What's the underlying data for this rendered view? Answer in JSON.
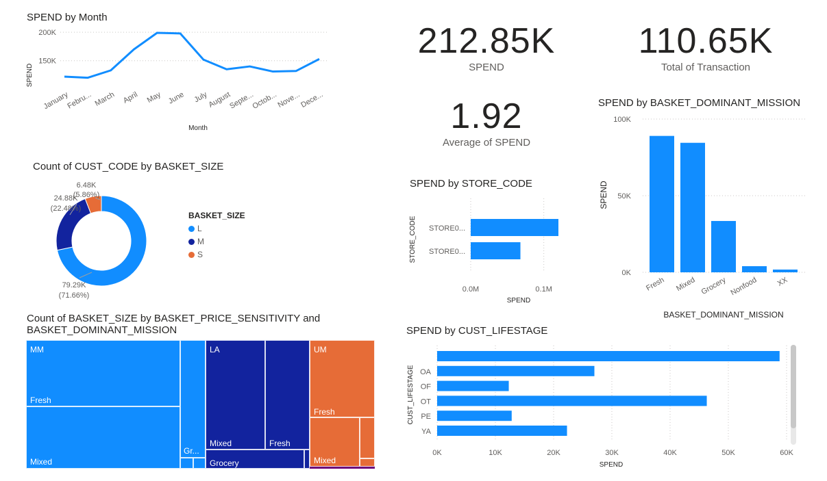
{
  "kpis": {
    "spend": {
      "value": "212.85K",
      "label": "SPEND"
    },
    "transactions": {
      "value": "110.65K",
      "label": "Total of Transaction"
    },
    "avg_spend": {
      "value": "1.92",
      "label": "Average of SPEND"
    }
  },
  "colors": {
    "blue": "#118dff",
    "navy": "#12239e",
    "orange": "#e66c37",
    "purple": "#6b007b"
  },
  "chart_data": [
    {
      "id": "spend_by_month",
      "type": "line",
      "title": "SPEND by Month",
      "xlabel": "Month",
      "ylabel": "SPEND",
      "categories": [
        "January",
        "Febru...",
        "March",
        "April",
        "May",
        "June",
        "July",
        "August",
        "Septe...",
        "Octob...",
        "Nove...",
        "Dece..."
      ],
      "values": [
        122,
        120,
        133,
        170,
        199,
        198,
        152,
        135,
        140,
        131,
        132,
        153
      ],
      "y_ticks": [
        {
          "v": 150,
          "label": "150K"
        },
        {
          "v": 200,
          "label": "200K"
        }
      ],
      "ylim": [
        110,
        205
      ],
      "grid": true
    },
    {
      "id": "cust_by_basket_size",
      "type": "pie",
      "donut": true,
      "title": "Count of CUST_CODE by BASKET_SIZE",
      "legend_title": "BASKET_SIZE",
      "slices": [
        {
          "name": "L",
          "value": 79.29,
          "label": "79.29K",
          "pct": "(71.66%)",
          "color": "#118dff"
        },
        {
          "name": "M",
          "value": 24.88,
          "label": "24.88K",
          "pct": "(22.48%)",
          "color": "#12239e"
        },
        {
          "name": "S",
          "value": 6.48,
          "label": "6.48K",
          "pct": "(5.86%)",
          "color": "#e66c37"
        }
      ]
    },
    {
      "id": "treemap",
      "type": "treemap",
      "title_line1": "Count of BASKET_SIZE by BASKET_PRICE_SENSITIVITY and",
      "title_line2": "BASKET_DOMINANT_MISSION",
      "groups": [
        {
          "name": "MM",
          "children": [
            "Fresh",
            "Mixed",
            "Gr..."
          ]
        },
        {
          "name": "LA",
          "children": [
            "Mixed",
            "Fresh",
            "Grocery"
          ]
        },
        {
          "name": "UM",
          "children": [
            "Fresh",
            "Mixed"
          ]
        }
      ]
    },
    {
      "id": "spend_by_store",
      "type": "bar",
      "orientation": "horizontal",
      "title": "SPEND by STORE_CODE",
      "xlabel": "SPEND",
      "ylabel": "STORE_CODE",
      "categories": [
        "STORE0...",
        "STORE0..."
      ],
      "values": [
        0.12,
        0.068
      ],
      "xlim": [
        0,
        0.12
      ],
      "x_ticks": [
        {
          "v": 0,
          "label": "0.0M"
        },
        {
          "v": 0.1,
          "label": "0.1M"
        }
      ]
    },
    {
      "id": "spend_by_mission",
      "type": "bar",
      "title": "SPEND by BASKET_DOMINANT_MISSION",
      "xlabel": "BASKET_DOMINANT_MISSION",
      "ylabel": "SPEND",
      "categories": [
        "Fresh",
        "Mixed",
        "Grocery",
        "Nonfood",
        "XX"
      ],
      "values": [
        89000,
        84500,
        33500,
        4000,
        1800
      ],
      "ylim": [
        0,
        100000
      ],
      "y_ticks": [
        {
          "v": 0,
          "label": "0K"
        },
        {
          "v": 50000,
          "label": "50K"
        },
        {
          "v": 100000,
          "label": "100K"
        }
      ]
    },
    {
      "id": "spend_by_lifestage",
      "type": "bar",
      "orientation": "horizontal",
      "title": "SPEND by CUST_LIFESTAGE",
      "xlabel": "SPEND",
      "ylabel": "CUST_LIFESTAGE",
      "categories": [
        "",
        "OA",
        "OF",
        "OT",
        "PE",
        "YA"
      ],
      "values": [
        58800,
        27000,
        12300,
        46300,
        12800,
        22300
      ],
      "xlim": [
        0,
        60000
      ],
      "x_ticks": [
        {
          "v": 0,
          "label": "0K"
        },
        {
          "v": 10000,
          "label": "10K"
        },
        {
          "v": 20000,
          "label": "20K"
        },
        {
          "v": 30000,
          "label": "30K"
        },
        {
          "v": 40000,
          "label": "40K"
        },
        {
          "v": 50000,
          "label": "50K"
        },
        {
          "v": 60000,
          "label": "60K"
        }
      ]
    }
  ]
}
